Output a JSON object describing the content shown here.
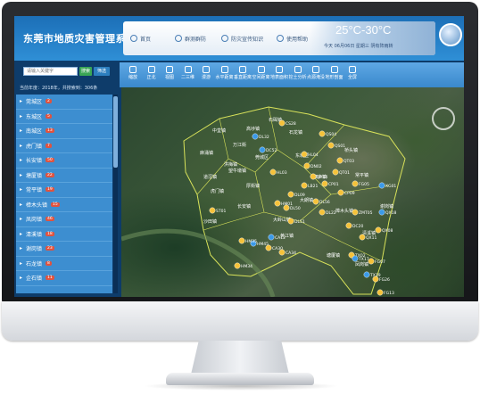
{
  "app": {
    "title": "东莞市地质灾害管理系统"
  },
  "nav": {
    "items": [
      {
        "label": "首页",
        "icon": "home-icon"
      },
      {
        "label": "群测群防",
        "icon": "group-icon"
      },
      {
        "label": "防灾宣传知识",
        "icon": "book-icon"
      },
      {
        "label": "使用帮助",
        "icon": "help-icon"
      }
    ]
  },
  "weather": {
    "temperature": "25°C-30°C",
    "detail": "今天 06月06日 星期三 阴有阵雨转"
  },
  "search": {
    "placeholder": "请输入关键字",
    "button": "搜索",
    "filter": "筛选"
  },
  "summary": {
    "count_text": "当前年度：2018年，共搜索到：306条"
  },
  "districts": [
    {
      "name": "莞城区",
      "count": "2"
    },
    {
      "name": "东城区",
      "count": "5"
    },
    {
      "name": "南城区",
      "count": "13"
    },
    {
      "name": "虎门镇",
      "count": "7"
    },
    {
      "name": "长安镇",
      "count": "50"
    },
    {
      "name": "塘厦镇",
      "count": "22"
    },
    {
      "name": "常平镇",
      "count": "19"
    },
    {
      "name": "樟木头镇",
      "count": "15"
    },
    {
      "name": "凤岗镇",
      "count": "46"
    },
    {
      "name": "清溪镇",
      "count": "18"
    },
    {
      "name": "谢岗镇",
      "count": "23"
    },
    {
      "name": "石龙镇",
      "count": "8"
    },
    {
      "name": "企石镇",
      "count": "11"
    }
  ],
  "toolbar": {
    "tools": [
      {
        "label": "缩放",
        "icon": "zoom-icon"
      },
      {
        "label": "正北",
        "icon": "north-icon"
      },
      {
        "label": "视图",
        "icon": "view-icon"
      },
      {
        "label": "二三维",
        "icon": "dimension-icon"
      },
      {
        "label": "漫游",
        "icon": "roam-icon"
      },
      {
        "label": "水平距离",
        "icon": "horizontal-distance-icon"
      },
      {
        "label": "垂直距离",
        "icon": "vertical-distance-icon"
      },
      {
        "label": "空间距离",
        "icon": "space-distance-icon"
      },
      {
        "label": "地表面积",
        "icon": "area-icon"
      },
      {
        "label": "挖土分析",
        "icon": "excavation-icon"
      },
      {
        "label": "点源淹没",
        "icon": "flood-icon"
      },
      {
        "label": "地形剖面",
        "icon": "profile-icon"
      },
      {
        "label": "全屏",
        "icon": "fullscreen-icon"
      }
    ]
  },
  "map": {
    "region_labels": [
      "中堂镇",
      "高埗镇",
      "石碣镇",
      "麻涌镇",
      "万江街",
      "洪梅镇",
      "石龙镇",
      "望牛墩镇",
      "道滘镇",
      "莞城区",
      "东城区",
      "虎门镇",
      "厚街镇",
      "长安镇",
      "沙田镇",
      "大岭山镇",
      "寮步镇",
      "大朗镇",
      "黄江镇",
      "常平镇",
      "樟木头镇",
      "清溪镇",
      "凤岗镇",
      "塘厦镇",
      "谢岗镇",
      "桥头镇"
    ],
    "points": [
      {
        "label": "CS28",
        "status": "hazard"
      },
      {
        "label": "DL32",
        "status": "normal"
      },
      {
        "label": "QS04",
        "status": "hazard"
      },
      {
        "label": "QS01",
        "status": "hazard"
      },
      {
        "label": "HL04",
        "status": "hazard"
      },
      {
        "label": "DN02",
        "status": "hazard"
      },
      {
        "label": "QT03",
        "status": "hazard"
      },
      {
        "label": "QT01",
        "status": "hazard"
      },
      {
        "label": "CP01",
        "status": "hazard"
      },
      {
        "label": "CP09",
        "status": "hazard"
      },
      {
        "label": "FG05",
        "status": "hazard"
      },
      {
        "label": "XG01",
        "status": "normal"
      },
      {
        "label": "DX04",
        "status": "hazard"
      },
      {
        "label": "DC52",
        "status": "normal"
      },
      {
        "label": "HM01",
        "status": "hazard"
      },
      {
        "label": "DL09",
        "status": "hazard"
      },
      {
        "label": "DL50",
        "status": "hazard"
      },
      {
        "label": "ST01",
        "status": "hazard"
      },
      {
        "label": "DL22",
        "status": "hazard"
      },
      {
        "label": "ZMT05",
        "status": "hazard"
      },
      {
        "label": "QX18",
        "status": "normal"
      },
      {
        "label": "HM45",
        "status": "normal"
      },
      {
        "label": "CA30",
        "status": "hazard"
      },
      {
        "label": "DL51",
        "status": "hazard"
      },
      {
        "label": "QX08",
        "status": "hazard"
      },
      {
        "label": "QX11",
        "status": "hazard"
      },
      {
        "label": "TX02",
        "status": "hazard"
      },
      {
        "label": "TX17",
        "status": "normal"
      },
      {
        "label": "TX19",
        "status": "normal"
      },
      {
        "label": "FG07",
        "status": "hazard"
      },
      {
        "label": "FG26",
        "status": "hazard"
      },
      {
        "label": "FG13",
        "status": "hazard"
      },
      {
        "label": "HM35",
        "status": "hazard"
      },
      {
        "label": "HM34",
        "status": "hazard"
      },
      {
        "label": "CA34",
        "status": "hazard"
      },
      {
        "label": "CA12",
        "status": "normal"
      },
      {
        "label": "DC20",
        "status": "hazard"
      },
      {
        "label": "LB21",
        "status": "hazard"
      },
      {
        "label": "DL56",
        "status": "hazard"
      },
      {
        "label": "HL03",
        "status": "hazard"
      }
    ]
  },
  "colors": {
    "accent": "#2f8fd6",
    "hazard_point": "#f5c23a",
    "normal_point": "#3b9ae8",
    "region_border": "#d8e25a"
  }
}
